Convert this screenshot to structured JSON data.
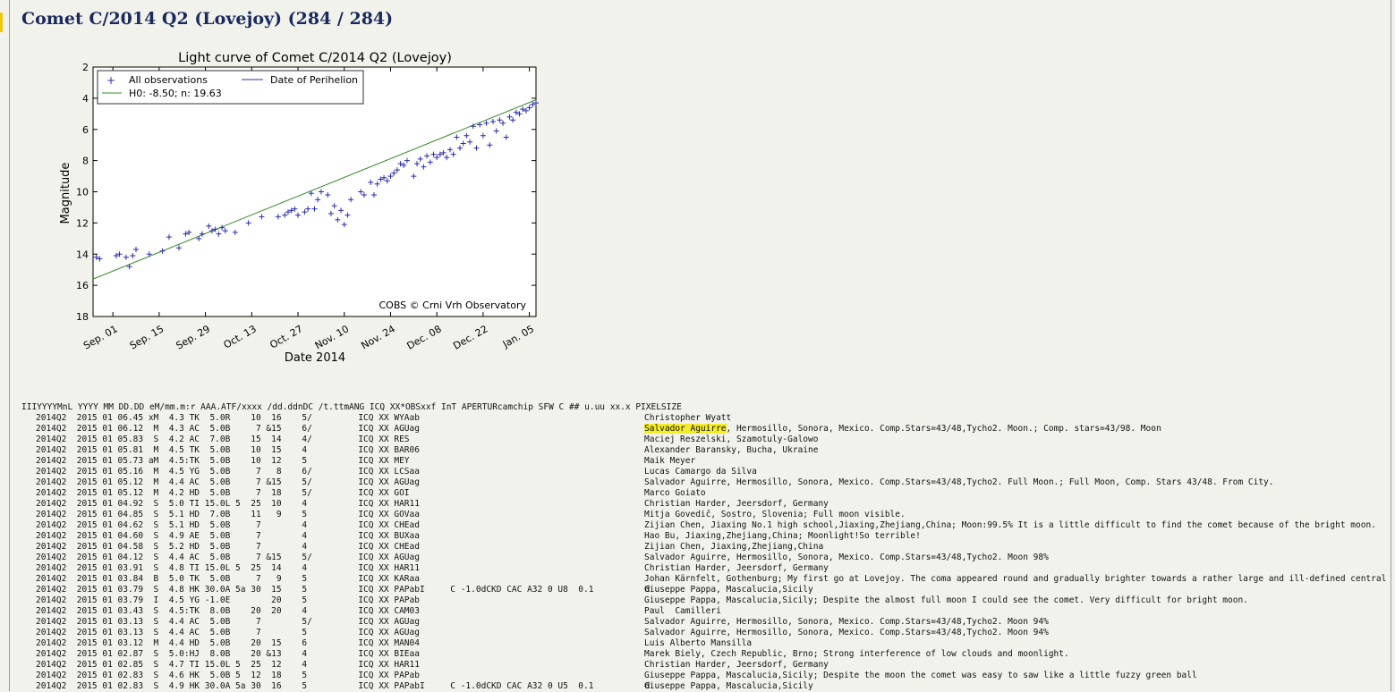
{
  "page": {
    "title": "Comet C/2014 Q2 (Lovejoy) (284 / 284)"
  },
  "chart_data": {
    "type": "scatter",
    "title": "Light curve of Comet C/2014 Q2 (Lovejoy)",
    "xlabel": "Date 2014",
    "ylabel": "Magnitude",
    "x_tick_labels": [
      "Sep. 01",
      "Sep. 15",
      "Sep. 29",
      "Oct. 13",
      "Oct. 27",
      "Nov. 10",
      "Nov. 24",
      "Dec. 08",
      "Dec. 22",
      "Jan. 05"
    ],
    "x_tick_values": [
      "2014-09-01",
      "2014-09-15",
      "2014-09-29",
      "2014-10-13",
      "2014-10-27",
      "2014-11-10",
      "2014-11-24",
      "2014-12-08",
      "2014-12-22",
      "2015-01-05"
    ],
    "xlim": [
      "2014-08-26",
      "2015-01-07"
    ],
    "ylim": [
      18,
      2
    ],
    "y_inverted": true,
    "y_ticks": [
      2,
      4,
      6,
      8,
      10,
      12,
      14,
      16,
      18
    ],
    "legend_position": "top-left",
    "legend": [
      "All observations",
      "Date of Perihelion",
      "H0: -8.50; n: 19.63"
    ],
    "annotation": "COBS © Crni Vrh Observatory",
    "colors": {
      "observations": "#2b2bb0",
      "fit": "#3a8a2a",
      "perihelion": "#2b2bb0"
    },
    "fit_line": {
      "start": [
        "2014-08-26",
        15.6
      ],
      "end": [
        "2015-01-07",
        4.1
      ]
    },
    "series": [
      {
        "name": "All observations",
        "points": [
          [
            "2014-08-27",
            14.2
          ],
          [
            "2014-08-28",
            14.3
          ],
          [
            "2014-09-02",
            14.1
          ],
          [
            "2014-09-03",
            14.0
          ],
          [
            "2014-09-05",
            14.2
          ],
          [
            "2014-09-06",
            14.8
          ],
          [
            "2014-09-07",
            14.1
          ],
          [
            "2014-09-08",
            13.7
          ],
          [
            "2014-09-12",
            14.0
          ],
          [
            "2014-09-16",
            13.8
          ],
          [
            "2014-09-18",
            12.9
          ],
          [
            "2014-09-21",
            13.6
          ],
          [
            "2014-09-23",
            12.7
          ],
          [
            "2014-09-24",
            12.6
          ],
          [
            "2014-09-27",
            13.0
          ],
          [
            "2014-09-28",
            12.7
          ],
          [
            "2014-09-30",
            12.2
          ],
          [
            "2014-10-01",
            12.5
          ],
          [
            "2014-10-02",
            12.4
          ],
          [
            "2014-10-03",
            12.7
          ],
          [
            "2014-10-04",
            12.3
          ],
          [
            "2014-10-05",
            12.5
          ],
          [
            "2014-10-08",
            12.6
          ],
          [
            "2014-10-12",
            12.0
          ],
          [
            "2014-10-16",
            11.6
          ],
          [
            "2014-10-21",
            11.6
          ],
          [
            "2014-10-23",
            11.5
          ],
          [
            "2014-10-24",
            11.3
          ],
          [
            "2014-10-25",
            11.2
          ],
          [
            "2014-10-26",
            11.1
          ],
          [
            "2014-10-27",
            11.5
          ],
          [
            "2014-10-29",
            11.3
          ],
          [
            "2014-10-30",
            11.1
          ],
          [
            "2014-10-31",
            10.1
          ],
          [
            "2014-11-01",
            11.1
          ],
          [
            "2014-11-02",
            10.5
          ],
          [
            "2014-11-03",
            10.0
          ],
          [
            "2014-11-05",
            10.2
          ],
          [
            "2014-11-06",
            11.4
          ],
          [
            "2014-11-07",
            10.9
          ],
          [
            "2014-11-08",
            11.8
          ],
          [
            "2014-11-09",
            11.2
          ],
          [
            "2014-11-10",
            12.1
          ],
          [
            "2014-11-11",
            11.5
          ],
          [
            "2014-11-12",
            10.5
          ],
          [
            "2014-11-15",
            10.0
          ],
          [
            "2014-11-16",
            10.2
          ],
          [
            "2014-11-18",
            9.4
          ],
          [
            "2014-11-19",
            10.2
          ],
          [
            "2014-11-20",
            9.5
          ],
          [
            "2014-11-21",
            9.2
          ],
          [
            "2014-11-22",
            9.1
          ],
          [
            "2014-11-23",
            9.3
          ],
          [
            "2014-11-24",
            9.0
          ],
          [
            "2014-11-25",
            8.8
          ],
          [
            "2014-11-26",
            8.6
          ],
          [
            "2014-11-27",
            8.2
          ],
          [
            "2014-11-28",
            8.3
          ],
          [
            "2014-11-29",
            8.0
          ],
          [
            "2014-12-01",
            9.0
          ],
          [
            "2014-12-02",
            8.2
          ],
          [
            "2014-12-03",
            7.9
          ],
          [
            "2014-12-04",
            8.4
          ],
          [
            "2014-12-05",
            7.7
          ],
          [
            "2014-12-06",
            8.1
          ],
          [
            "2014-12-07",
            7.6
          ],
          [
            "2014-12-08",
            7.8
          ],
          [
            "2014-12-09",
            7.6
          ],
          [
            "2014-12-10",
            7.5
          ],
          [
            "2014-12-11",
            7.8
          ],
          [
            "2014-12-12",
            7.3
          ],
          [
            "2014-12-13",
            7.6
          ],
          [
            "2014-12-14",
            6.5
          ],
          [
            "2014-12-15",
            7.2
          ],
          [
            "2014-12-16",
            6.9
          ],
          [
            "2014-12-17",
            6.4
          ],
          [
            "2014-12-18",
            6.8
          ],
          [
            "2014-12-19",
            5.8
          ],
          [
            "2014-12-20",
            7.2
          ],
          [
            "2014-12-21",
            5.7
          ],
          [
            "2014-12-22",
            6.4
          ],
          [
            "2014-12-23",
            5.6
          ],
          [
            "2014-12-24",
            7.0
          ],
          [
            "2014-12-25",
            5.5
          ],
          [
            "2014-12-26",
            6.1
          ],
          [
            "2014-12-27",
            5.4
          ],
          [
            "2014-12-28",
            5.6
          ],
          [
            "2014-12-29",
            6.5
          ],
          [
            "2014-12-30",
            5.2
          ],
          [
            "2014-12-31",
            5.4
          ],
          [
            "2015-01-01",
            4.9
          ],
          [
            "2015-01-02",
            5.0
          ],
          [
            "2015-01-03",
            4.7
          ],
          [
            "2015-01-04",
            4.8
          ],
          [
            "2015-01-05",
            4.6
          ],
          [
            "2015-01-06",
            4.4
          ],
          [
            "2015-01-07",
            4.3
          ]
        ]
      }
    ]
  },
  "observations": {
    "header": "IIIYYYYMnL YYYY MM DD.DD eM/mm.m:r AAA.ATF/xxxx /dd.ddnDC /t.ttmANG ICQ XX*OBSxxf InT APERTURcamchip SFW C ## u.uu xx.x PIXELSIZE",
    "rows": [
      {
        "data": "2014Q2  2015 01 06.45 xM  4.3 TK  5.0R    10  16    5/         ICQ XX WYAab",
        "observer": "Christopher Wyatt"
      },
      {
        "data": "2014Q2  2015 01 06.12  M  4.3 AC  5.0B     7 &15    6/         ICQ XX AGUag",
        "observer": "Salvador Aguirre",
        "observer_rest": ", Hermosillo, Sonora, Mexico. Comp.Stars=43/48,Tycho2. Moon.; Comp. stars=43/98. Moon"
      },
      {
        "data": "2014Q2  2015 01 05.83  S  4.2 AC  7.0B    15  14    4/         ICQ XX RES",
        "observer": "Maciej Reszelski, Szamotuly-Galowo"
      },
      {
        "data": "2014Q2  2015 01 05.81  M  4.5 TK  5.0B    10  15    4          ICQ XX BAR06",
        "observer": "Alexander Baransky, Bucha, Ukraine"
      },
      {
        "data": "2014Q2  2015 01 05.73 aM  4.5:TK  5.0B    10  12    5          ICQ XX MEY",
        "observer": "Maik Meyer"
      },
      {
        "data": "2014Q2  2015 01 05.16  M  4.5 YG  5.0B     7   8    6/         ICQ XX LCSaa",
        "observer": "Lucas Camargo da Silva"
      },
      {
        "data": "2014Q2  2015 01 05.12  M  4.4 AC  5.0B     7 &15    5/         ICQ XX AGUag",
        "observer": "Salvador Aguirre, Hermosillo, Sonora, Mexico. Comp.Stars=43/48,Tycho2. Full Moon.; Full Moon, Comp. Stars 43/48. From City."
      },
      {
        "data": "2014Q2  2015 01 05.12  M  4.2 HD  5.0B     7  18    5/         ICQ XX GOI",
        "observer": "Marco Goiato"
      },
      {
        "data": "2014Q2  2015 01 04.92  S  5.0 TI 15.0L 5  25  10    4          ICQ XX HAR11",
        "observer": "Christian Harder, Jeersdorf, Germany"
      },
      {
        "data": "2014Q2  2015 01 04.85  S  5.1 HD  7.0B    11   9    5          ICQ XX GOVaa",
        "observer": "Mitja Govedič, Sostro, Slovenia; Full moon visible."
      },
      {
        "data": "2014Q2  2015 01 04.62  S  5.1 HD  5.0B     7        4          ICQ XX CHEad",
        "observer": "Zijian Chen, Jiaxing No.1 high school,Jiaxing,Zhejiang,China; Moon:99.5% It is a little difficult to find the comet because of the bright moon."
      },
      {
        "data": "2014Q2  2015 01 04.60  S  4.9 AE  5.0B     7        4          ICQ XX BUXaa",
        "observer": "Hao Bu, Jiaxing,Zhejiang,China; Moonlight!So terrible!"
      },
      {
        "data": "2014Q2  2015 01 04.58  S  5.2 HD  5.0B     7        4          ICQ XX CHEad",
        "observer": "Zijian Chen, Jiaxing,Zhejiang,China"
      },
      {
        "data": "2014Q2  2015 01 04.12  S  4.4 AC  5.0B     7 &15    5/         ICQ XX AGUag",
        "observer": "Salvador Aguirre, Hermosillo, Sonora, Mexico. Comp.Stars=43/48,Tycho2. Moon 98%"
      },
      {
        "data": "2014Q2  2015 01 03.91  S  4.8 TI 15.0L 5  25  14    4          ICQ XX HAR11",
        "observer": "Christian Harder, Jeersdorf, Germany"
      },
      {
        "data": "2014Q2  2015 01 03.84  B  5.0 TK  5.0B     7   9    5          ICQ XX KARaa",
        "observer": "Johan Kärnfelt, Gothenburg; My first go at Lovejoy. The coma appeared round and gradually brighter towards a rather large and ill-defined central disk. No t"
      },
      {
        "data": "2014Q2  2015 01 03.79  S  4.8 HK 30.0A 5a 30  15    5          ICQ XX PAPabI     C -1.0dCKD CAC A32 0 U8  0.1          d",
        "observer": "Giuseppe Pappa, Mascalucia,Sicily"
      },
      {
        "data": "2014Q2  2015 01 03.79  I  4.5 YG -1.0E        20    5          ICQ XX PAPab",
        "observer": "Giuseppe Pappa, Mascalucia,Sicily; Despite the almost full moon I could see the comet. Very difficult for bright moon."
      },
      {
        "data": "2014Q2  2015 01 03.43  S  4.5:TK  8.0B    20  20    4          ICQ XX CAM03",
        "observer": "Paul  Camilleri"
      },
      {
        "data": "2014Q2  2015 01 03.13  S  4.4 AC  5.0B     7        5/         ICQ XX AGUag",
        "observer": "Salvador Aguirre, Hermosillo, Sonora, Mexico. Comp.Stars=43/48,Tycho2. Moon 94%"
      },
      {
        "data": "2014Q2  2015 01 03.13  S  4.4 AC  5.0B     7        5          ICQ XX AGUag",
        "observer": "Salvador Aguirre, Hermosillo, Sonora, Mexico. Comp.Stars=43/48,Tycho2. Moon 94%"
      },
      {
        "data": "2014Q2  2015 01 03.12  M  4.4 HD  5.0B    20  15    6          ICQ XX MAN04",
        "observer": "Luis Alberto Mansilla"
      },
      {
        "data": "2014Q2  2015 01 02.87  S  5.0:HJ  8.0B    20 &13    4          ICQ XX BIEaa",
        "observer": "Marek Biely, Czech Republic, Brno; Strong interference of low clouds and moonlight."
      },
      {
        "data": "2014Q2  2015 01 02.85  S  4.7 TI 15.0L 5  25  12    4          ICQ XX HAR11",
        "observer": "Christian Harder, Jeersdorf, Germany"
      },
      {
        "data": "2014Q2  2015 01 02.83  S  4.6 HK  5.0B 5  12  18    5          ICQ XX PAPab",
        "observer": "Giuseppe Pappa, Mascalucia,Sicily; Despite the moon the comet was easy to saw like a little fuzzy green ball"
      },
      {
        "data": "2014Q2  2015 01 02.83  S  4.9 HK 30.0A 5a 30  16    5          ICQ XX PAPabI     C -1.0dCKD CAC A32 0 U5  0.1          d",
        "observer": "Giuseppe Pappa, Mascalucia,Sicily"
      }
    ]
  }
}
